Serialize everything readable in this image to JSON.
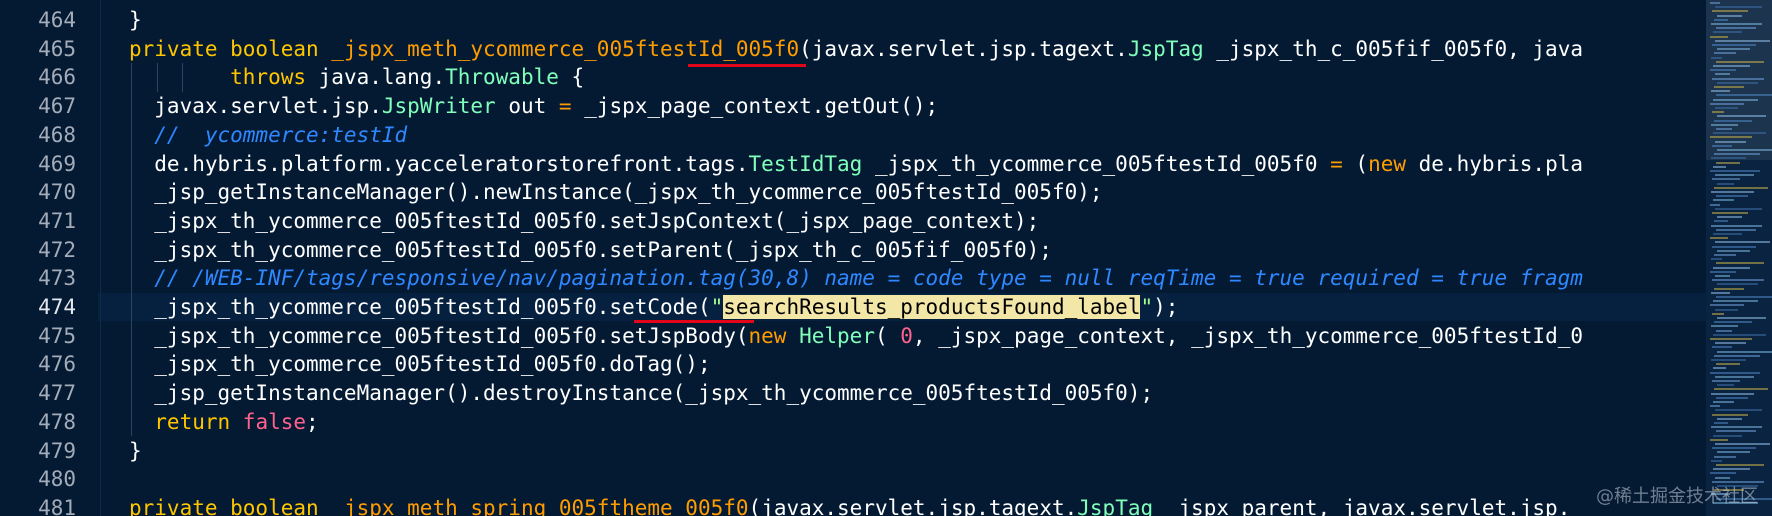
{
  "editor": {
    "line_numbers": [
      "464",
      "465",
      "466",
      "467",
      "468",
      "469",
      "470",
      "471",
      "472",
      "473",
      "474",
      "475",
      "476",
      "477",
      "478",
      "479",
      "480",
      "481"
    ],
    "current_line": "474",
    "lines": [
      {
        "segments": [
          {
            "t": "}",
            "c": ""
          }
        ]
      },
      {
        "segments": [
          {
            "t": "private boolean ",
            "c": "kw"
          },
          {
            "t": "_jspx_meth_ycommerce_005ftestId_005f0",
            "c": "kw2"
          },
          {
            "t": "(javax.servlet.jsp.tagext.",
            "c": ""
          },
          {
            "t": "JspTag",
            "c": "ty"
          },
          {
            "t": " _jspx_th_c_005fif_005f0, java",
            "c": ""
          }
        ]
      },
      {
        "segments": [
          {
            "t": "        throws ",
            "c": "kw"
          },
          {
            "t": "java.lang.",
            "c": ""
          },
          {
            "t": "Throwable",
            "c": "ty"
          },
          {
            "t": " {",
            "c": ""
          }
        ]
      },
      {
        "segments": [
          {
            "t": "  javax.servlet.jsp.",
            "c": ""
          },
          {
            "t": "JspWriter",
            "c": "ty"
          },
          {
            "t": " out ",
            "c": ""
          },
          {
            "t": "=",
            "c": "kw2"
          },
          {
            "t": " _jspx_page_context.getOut();",
            "c": ""
          }
        ]
      },
      {
        "segments": [
          {
            "t": "  //  ycommerce:testId",
            "c": "cm"
          }
        ]
      },
      {
        "segments": [
          {
            "t": "  de.hybris.platform.yacceleratorstorefront.tags.",
            "c": ""
          },
          {
            "t": "TestIdTag",
            "c": "ty"
          },
          {
            "t": " _jspx_th_ycommerce_005ftestId_005f0 ",
            "c": ""
          },
          {
            "t": "=",
            "c": "kw2"
          },
          {
            "t": " (",
            "c": ""
          },
          {
            "t": "new",
            "c": "kw2"
          },
          {
            "t": " de.hybris.pla",
            "c": ""
          }
        ]
      },
      {
        "segments": [
          {
            "t": "  _jsp_getInstanceManager().newInstance(_jspx_th_ycommerce_005ftestId_005f0);",
            "c": ""
          }
        ]
      },
      {
        "segments": [
          {
            "t": "  _jspx_th_ycommerce_005ftestId_005f0.setJspContext(_jspx_page_context);",
            "c": ""
          }
        ]
      },
      {
        "segments": [
          {
            "t": "  _jspx_th_ycommerce_005ftestId_005f0.setParent(_jspx_th_c_005fif_005f0);",
            "c": ""
          }
        ]
      },
      {
        "segments": [
          {
            "t": "  // /WEB-INF/tags/responsive/nav/pagination.tag(30,8) name = code type = null reqTime = true required = true fragm",
            "c": "cm"
          }
        ]
      },
      {
        "segments": [
          {
            "t": "  _jspx_th_ycommerce_005ftestId_005f0.setCode(",
            "c": ""
          },
          {
            "t": "\"",
            "c": "str"
          },
          {
            "t": "searchResults_productsFound_label",
            "c": "hl"
          },
          {
            "t": "\"",
            "c": "str"
          },
          {
            "t": ");",
            "c": ""
          }
        ]
      },
      {
        "segments": [
          {
            "t": "  _jspx_th_ycommerce_005ftestId_005f0.setJspBody(",
            "c": ""
          },
          {
            "t": "new",
            "c": "kw2"
          },
          {
            "t": " ",
            "c": ""
          },
          {
            "t": "Helper",
            "c": "ty"
          },
          {
            "t": "( ",
            "c": ""
          },
          {
            "t": "0",
            "c": "num"
          },
          {
            "t": ", _jspx_page_context, _jspx_th_ycommerce_005ftestId_0",
            "c": ""
          }
        ]
      },
      {
        "segments": [
          {
            "t": "  _jspx_th_ycommerce_005ftestId_005f0.doTag();",
            "c": ""
          }
        ]
      },
      {
        "segments": [
          {
            "t": "  _jsp_getInstanceManager().destroyInstance(_jspx_th_ycommerce_005ftestId_005f0);",
            "c": ""
          }
        ]
      },
      {
        "segments": [
          {
            "t": "  return ",
            "c": "kw"
          },
          {
            "t": "false",
            "c": "bool"
          },
          {
            "t": ";",
            "c": ""
          }
        ]
      },
      {
        "segments": [
          {
            "t": "}",
            "c": ""
          }
        ]
      },
      {
        "segments": [
          {
            "t": "",
            "c": ""
          }
        ]
      },
      {
        "segments": [
          {
            "t": "private boolean ",
            "c": "kw"
          },
          {
            "t": "_jspx_meth_spring_005ftheme_005f0",
            "c": "kw2"
          },
          {
            "t": "(javax.servlet.jsp.tagext.",
            "c": ""
          },
          {
            "t": "JspTag",
            "c": "ty"
          },
          {
            "t": " _jspx_parent, javax.servlet.jsp.",
            "c": ""
          }
        ]
      }
    ]
  },
  "watermark": "@稀土掘金技术社区",
  "colors": {
    "background": "#041a33",
    "keyword": "#ffc600",
    "operator": "#ff9d00",
    "comment": "#2f88ff",
    "type": "#80ffbb",
    "highlight": "#f3e7a8",
    "annotation_underline": "#e3061a"
  }
}
